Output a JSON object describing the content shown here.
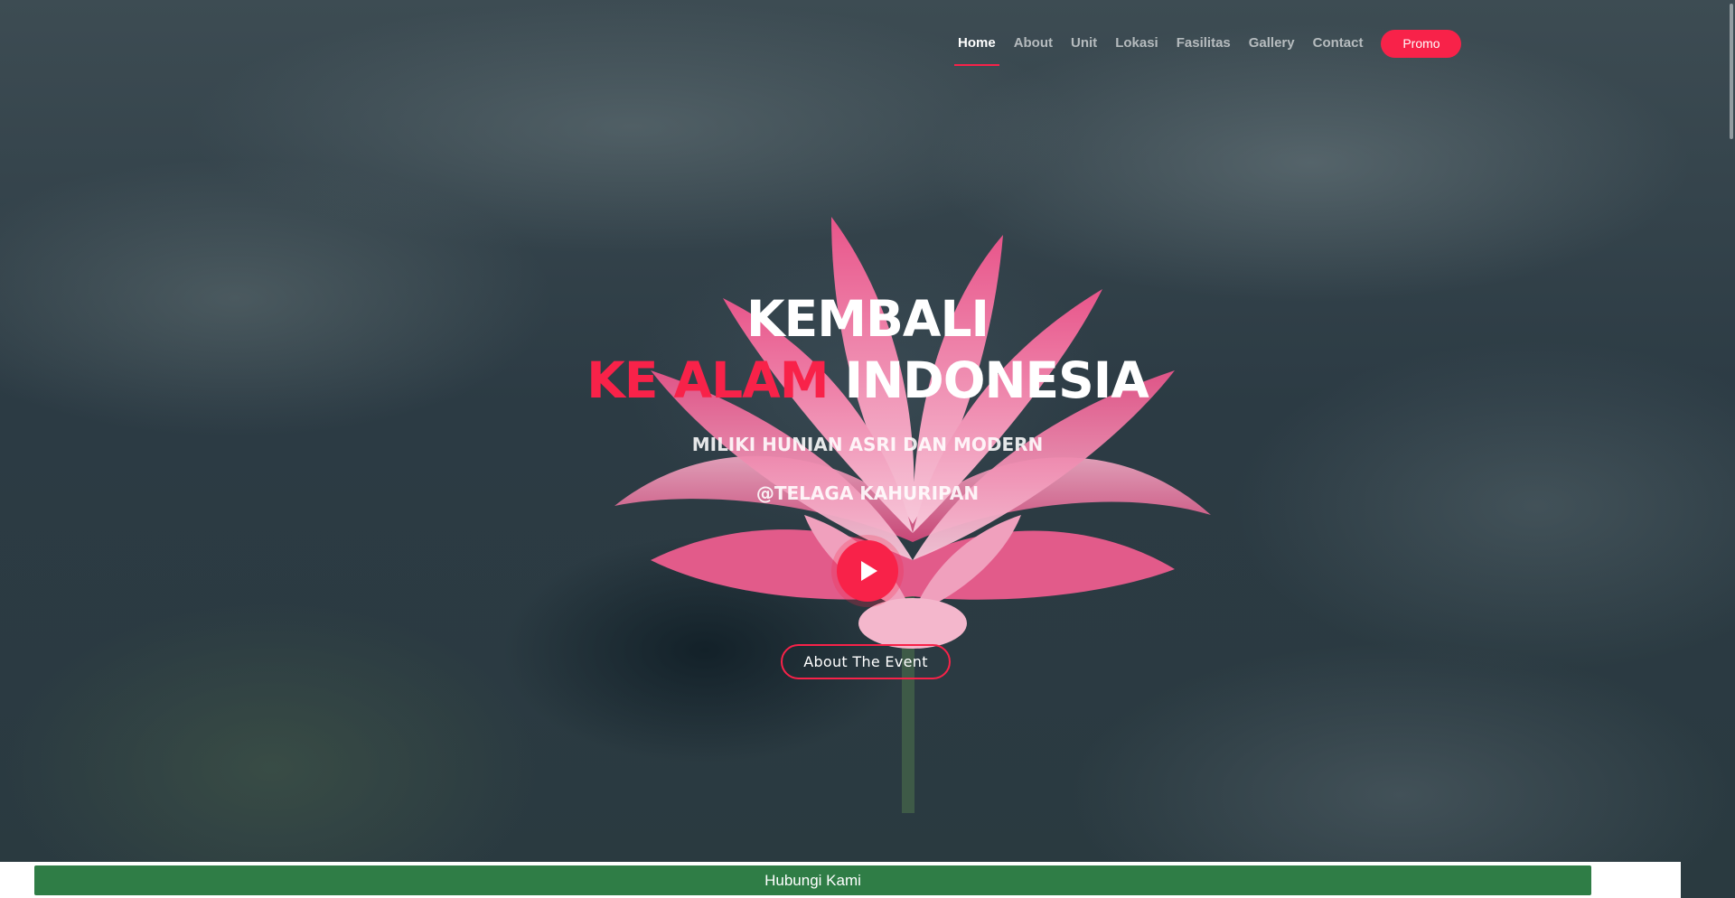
{
  "nav": {
    "items": [
      {
        "label": "Home",
        "active": true
      },
      {
        "label": "About",
        "active": false
      },
      {
        "label": "Unit",
        "active": false
      },
      {
        "label": "Lokasi",
        "active": false
      },
      {
        "label": "Fasilitas",
        "active": false
      },
      {
        "label": "Gallery",
        "active": false
      },
      {
        "label": "Contact",
        "active": false
      }
    ],
    "promo_label": "Promo"
  },
  "hero": {
    "line1": "KEMBALI",
    "line2_accent": "KE ALAM",
    "line2_rest": " INDONESIA",
    "subtitle1": "MILIKI HUNIAN ASRI DAN MODERN",
    "subtitle2": "@TELAGA KAHURIPAN",
    "play_icon": "play-icon",
    "cta_label": "About The Event"
  },
  "footer": {
    "contact_label": "Hubungi Kami"
  },
  "colors": {
    "accent": "#f82249",
    "contact_bar": "#2f7d46"
  }
}
